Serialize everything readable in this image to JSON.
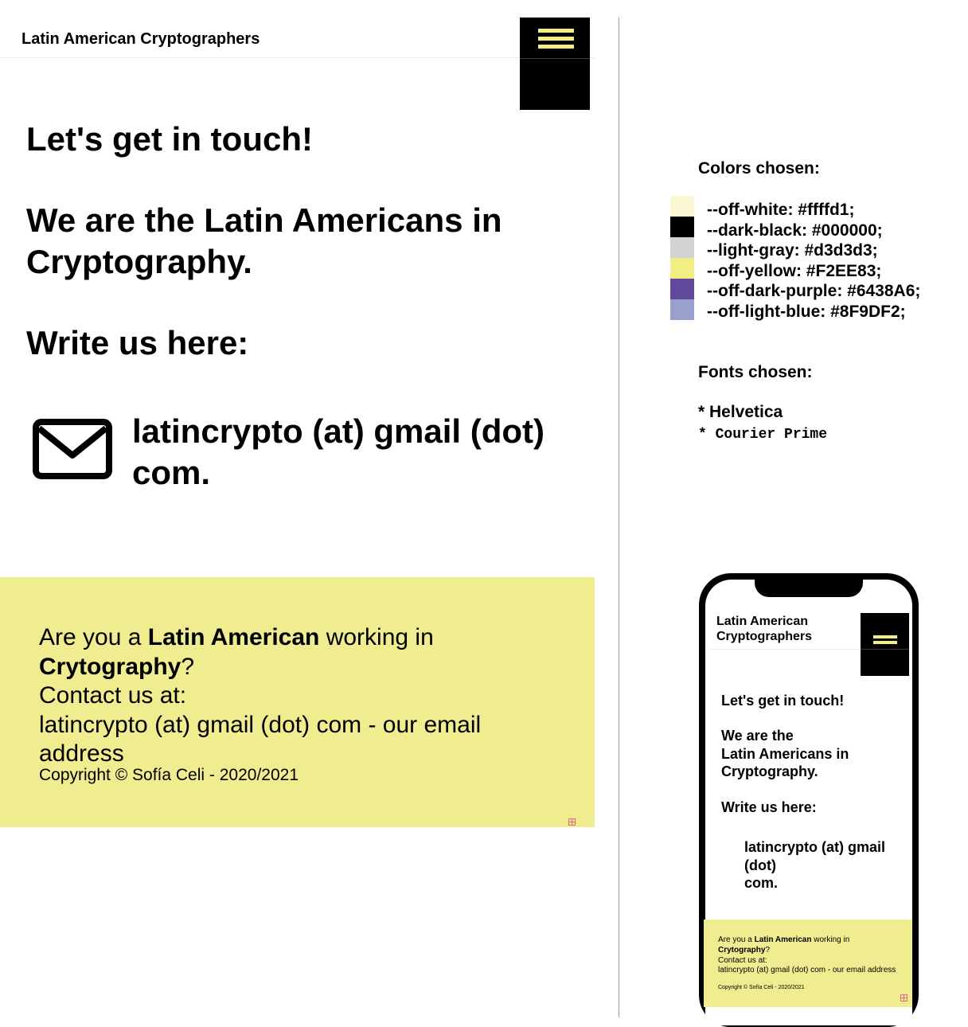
{
  "header": {
    "site_title": "Latin American Cryptographers"
  },
  "main": {
    "heading_touch": "Let's get in touch!",
    "heading_we": "We are the Latin Americans in Cryptography.",
    "heading_write": "Write us here:",
    "email_line1": "latincrypto (at) gmail (dot)",
    "email_line2": "com."
  },
  "footer": {
    "line1_prefix": "Are you a ",
    "line1_bold": "Latin American",
    "line1_suffix": " working in",
    "line2_bold": "Crytography",
    "line2_suffix": "?",
    "line3": "Contact us at:",
    "line4": "latincrypto (at) gmail (dot) com - our email address",
    "copyright": "Copyright © Sofía Celi - 2020/2021"
  },
  "style_guide": {
    "colors_heading": "Colors chosen:",
    "colors": [
      {
        "label": "--off-white: #ffffd1;",
        "hex": "#ffffd1",
        "swatch": "#fbf8d6"
      },
      {
        "label": "--dark-black: #000000;",
        "hex": "#000000",
        "swatch": "#000000"
      },
      {
        "label": "--light-gray: #d3d3d3;",
        "hex": "#d3d3d3",
        "swatch": "#d3d3d3"
      },
      {
        "label": "--off-yellow: #F2EE83;",
        "hex": "#F2EE83",
        "swatch": "#F2EE83"
      },
      {
        "label": "--off-dark-purple: #6438A6;",
        "hex": "#6438A6",
        "swatch": "#5f4a9c"
      },
      {
        "label": "--off-light-blue: #8F9DF2;",
        "hex": "#8F9DF2",
        "swatch": "#98a0cc"
      }
    ],
    "fonts_heading": "Fonts chosen:",
    "fonts": [
      "* Helvetica",
      "* Courier Prime"
    ]
  },
  "phone": {
    "site_title": "Latin American Cryptographers",
    "heading_touch": "Let's get in touch!",
    "heading_we_1": "We are the",
    "heading_we_2": "Latin Americans in",
    "heading_we_3": "Cryptography.",
    "heading_write": "Write us here:",
    "email_1": "latincrypto (at) gmail",
    "email_2": "(dot)",
    "email_3": "com.",
    "footer_prefix": "Are you a ",
    "footer_bold1": "Latin American",
    "footer_suffix1": " working in",
    "footer_bold2": "Crytography",
    "footer_suffix2": "?",
    "footer_line3": "Contact us at:",
    "footer_line4": "latincrypto (at) gmail (dot) com - our email address",
    "copyright": "Copyright © Sofía Celi - 2020/2021"
  },
  "icons": {
    "menu": "hamburger-menu-icon",
    "email": "envelope-icon",
    "badge": "expand-plus-icon"
  },
  "theme": {
    "accent_yellow": "#F2EE83",
    "black": "#000000"
  }
}
